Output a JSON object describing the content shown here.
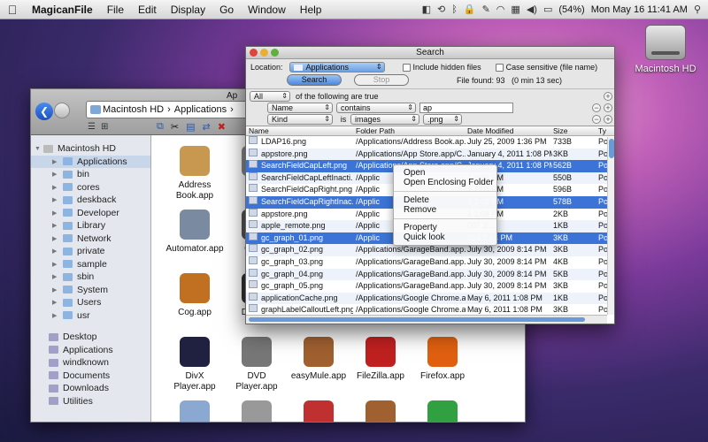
{
  "menubar": {
    "app": "MagicanFile",
    "items": [
      "File",
      "Edit",
      "Display",
      "Go",
      "Window",
      "Help"
    ],
    "battery": "(54%)",
    "clock": "Mon May 16  11:41 AM"
  },
  "desktop": {
    "drive_label": "Macintosh HD"
  },
  "finder": {
    "path": [
      "Macintosh HD",
      "Applications"
    ],
    "title_fragment": "Ap",
    "sidebar": {
      "disk": "Macintosh HD",
      "folders": [
        "Applications",
        "bin",
        "cores",
        "deskback",
        "Developer",
        "Library",
        "Network",
        "private",
        "sample",
        "sbin",
        "System",
        "Users",
        "usr"
      ],
      "favorites": [
        "Desktop",
        "Applications",
        "windknown",
        "Documents",
        "Downloads",
        "Utilities"
      ]
    },
    "icons": [
      {
        "label": "Address Book.app",
        "color": "#c89850"
      },
      {
        "label": "Ad",
        "color": "#888"
      },
      {
        "label": "Automator.app",
        "color": "#7a8aa0"
      },
      {
        "label": "Calcul",
        "color": "#555"
      },
      {
        "label": "Cog.app",
        "color": "#c07020"
      },
      {
        "label": "Dashbo",
        "color": "#333"
      },
      {
        "label": "DivX Player.app",
        "color": "#202040"
      },
      {
        "label": "DVD Player.app",
        "color": "#777"
      },
      {
        "label": "easyMule.app",
        "color": "#a06030"
      },
      {
        "label": "FileZilla.app",
        "color": "#c02020"
      },
      {
        "label": "Firefox.app",
        "color": "#e06010"
      },
      {
        "label": "",
        "color": "#8aa8d0"
      },
      {
        "label": "",
        "color": "#999"
      },
      {
        "label": "",
        "color": "#c03030"
      },
      {
        "label": "",
        "color": "#a06030"
      },
      {
        "label": "",
        "color": "#30a040"
      }
    ]
  },
  "search": {
    "title": "Search",
    "location_label": "Location:",
    "location_value": "Applications",
    "include_hidden": "Include hidden files",
    "case_sensitive": "Case sensitive (file name)",
    "search_btn": "Search",
    "stop_btn": "Stop",
    "status": "File found: 93   (0 min 13 sec)",
    "match": "All",
    "match_suffix": "of the following are true",
    "criteria": [
      {
        "field": "Name",
        "op": "contains",
        "value": "ap"
      },
      {
        "field": "Kind",
        "op": "is",
        "value": "images",
        "value2": ".png"
      }
    ],
    "columns": [
      "Name",
      "Folder Path",
      "Date Modified",
      "Size",
      "Ty"
    ],
    "rows": [
      {
        "name": "LDAP16.png",
        "path": "/Applications/Address Book.ap...",
        "date": "July 25, 2009 1:36 PM",
        "size": "733B",
        "type": "Po",
        "sel": false
      },
      {
        "name": "appstore.png",
        "path": "/Applications/App Store.app/C...",
        "date": "January 4, 2011 1:08 PM",
        "size": "3KB",
        "type": "Po",
        "sel": false
      },
      {
        "name": "SearchFieldCapLeft.png",
        "path": "/Applications/App Store.app/C...",
        "date": "January 4, 2011 1:08 PM",
        "size": "562B",
        "type": "Po",
        "sel": true
      },
      {
        "name": "SearchFieldCapLeftInacti...",
        "path": "/Applic",
        "date": "1 1:08 PM",
        "size": "550B",
        "type": "Po",
        "sel": false
      },
      {
        "name": "SearchFieldCapRight.png",
        "path": "/Applic",
        "date": "1 1:08 PM",
        "size": "596B",
        "type": "Po",
        "sel": false
      },
      {
        "name": "SearchFieldCapRightInac...",
        "path": "/Applic",
        "date": "1 1:08 PM",
        "size": "578B",
        "type": "Po",
        "sel": true
      },
      {
        "name": "appstore.png",
        "path": "/Applic",
        "date": "1 1:08 PM",
        "size": "2KB",
        "type": "Po",
        "sel": false
      },
      {
        "name": "apple_remote.png",
        "path": "/Applic",
        "date": "007 2:...",
        "size": "1KB",
        "type": "Po",
        "sel": false
      },
      {
        "name": "gc_graph_01.png",
        "path": "/Applic",
        "date": "009 8:14 PM",
        "size": "3KB",
        "type": "Po",
        "sel": true
      },
      {
        "name": "gc_graph_02.png",
        "path": "/Applications/GarageBand.app...",
        "date": "July 30, 2009 8:14 PM",
        "size": "3KB",
        "type": "Po",
        "sel": false
      },
      {
        "name": "gc_graph_03.png",
        "path": "/Applications/GarageBand.app...",
        "date": "July 30, 2009 8:14 PM",
        "size": "4KB",
        "type": "Po",
        "sel": false
      },
      {
        "name": "gc_graph_04.png",
        "path": "/Applications/GarageBand.app...",
        "date": "July 30, 2009 8:14 PM",
        "size": "5KB",
        "type": "Po",
        "sel": false
      },
      {
        "name": "gc_graph_05.png",
        "path": "/Applications/GarageBand.app...",
        "date": "July 30, 2009 8:14 PM",
        "size": "3KB",
        "type": "Po",
        "sel": false
      },
      {
        "name": "applicationCache.png",
        "path": "/Applications/Google Chrome.a...",
        "date": "May 6, 2011 1:08 PM",
        "size": "1KB",
        "type": "Po",
        "sel": false
      },
      {
        "name": "graphLabelCalloutLeft.png",
        "path": "/Applications/Google Chrome.a...",
        "date": "May 6, 2011 1:08 PM",
        "size": "3KB",
        "type": "Po",
        "sel": false
      }
    ]
  },
  "context_menu": [
    "Open",
    "Open Enclosing Folder",
    "Delete",
    "Remove",
    "Property",
    "Quick look"
  ]
}
